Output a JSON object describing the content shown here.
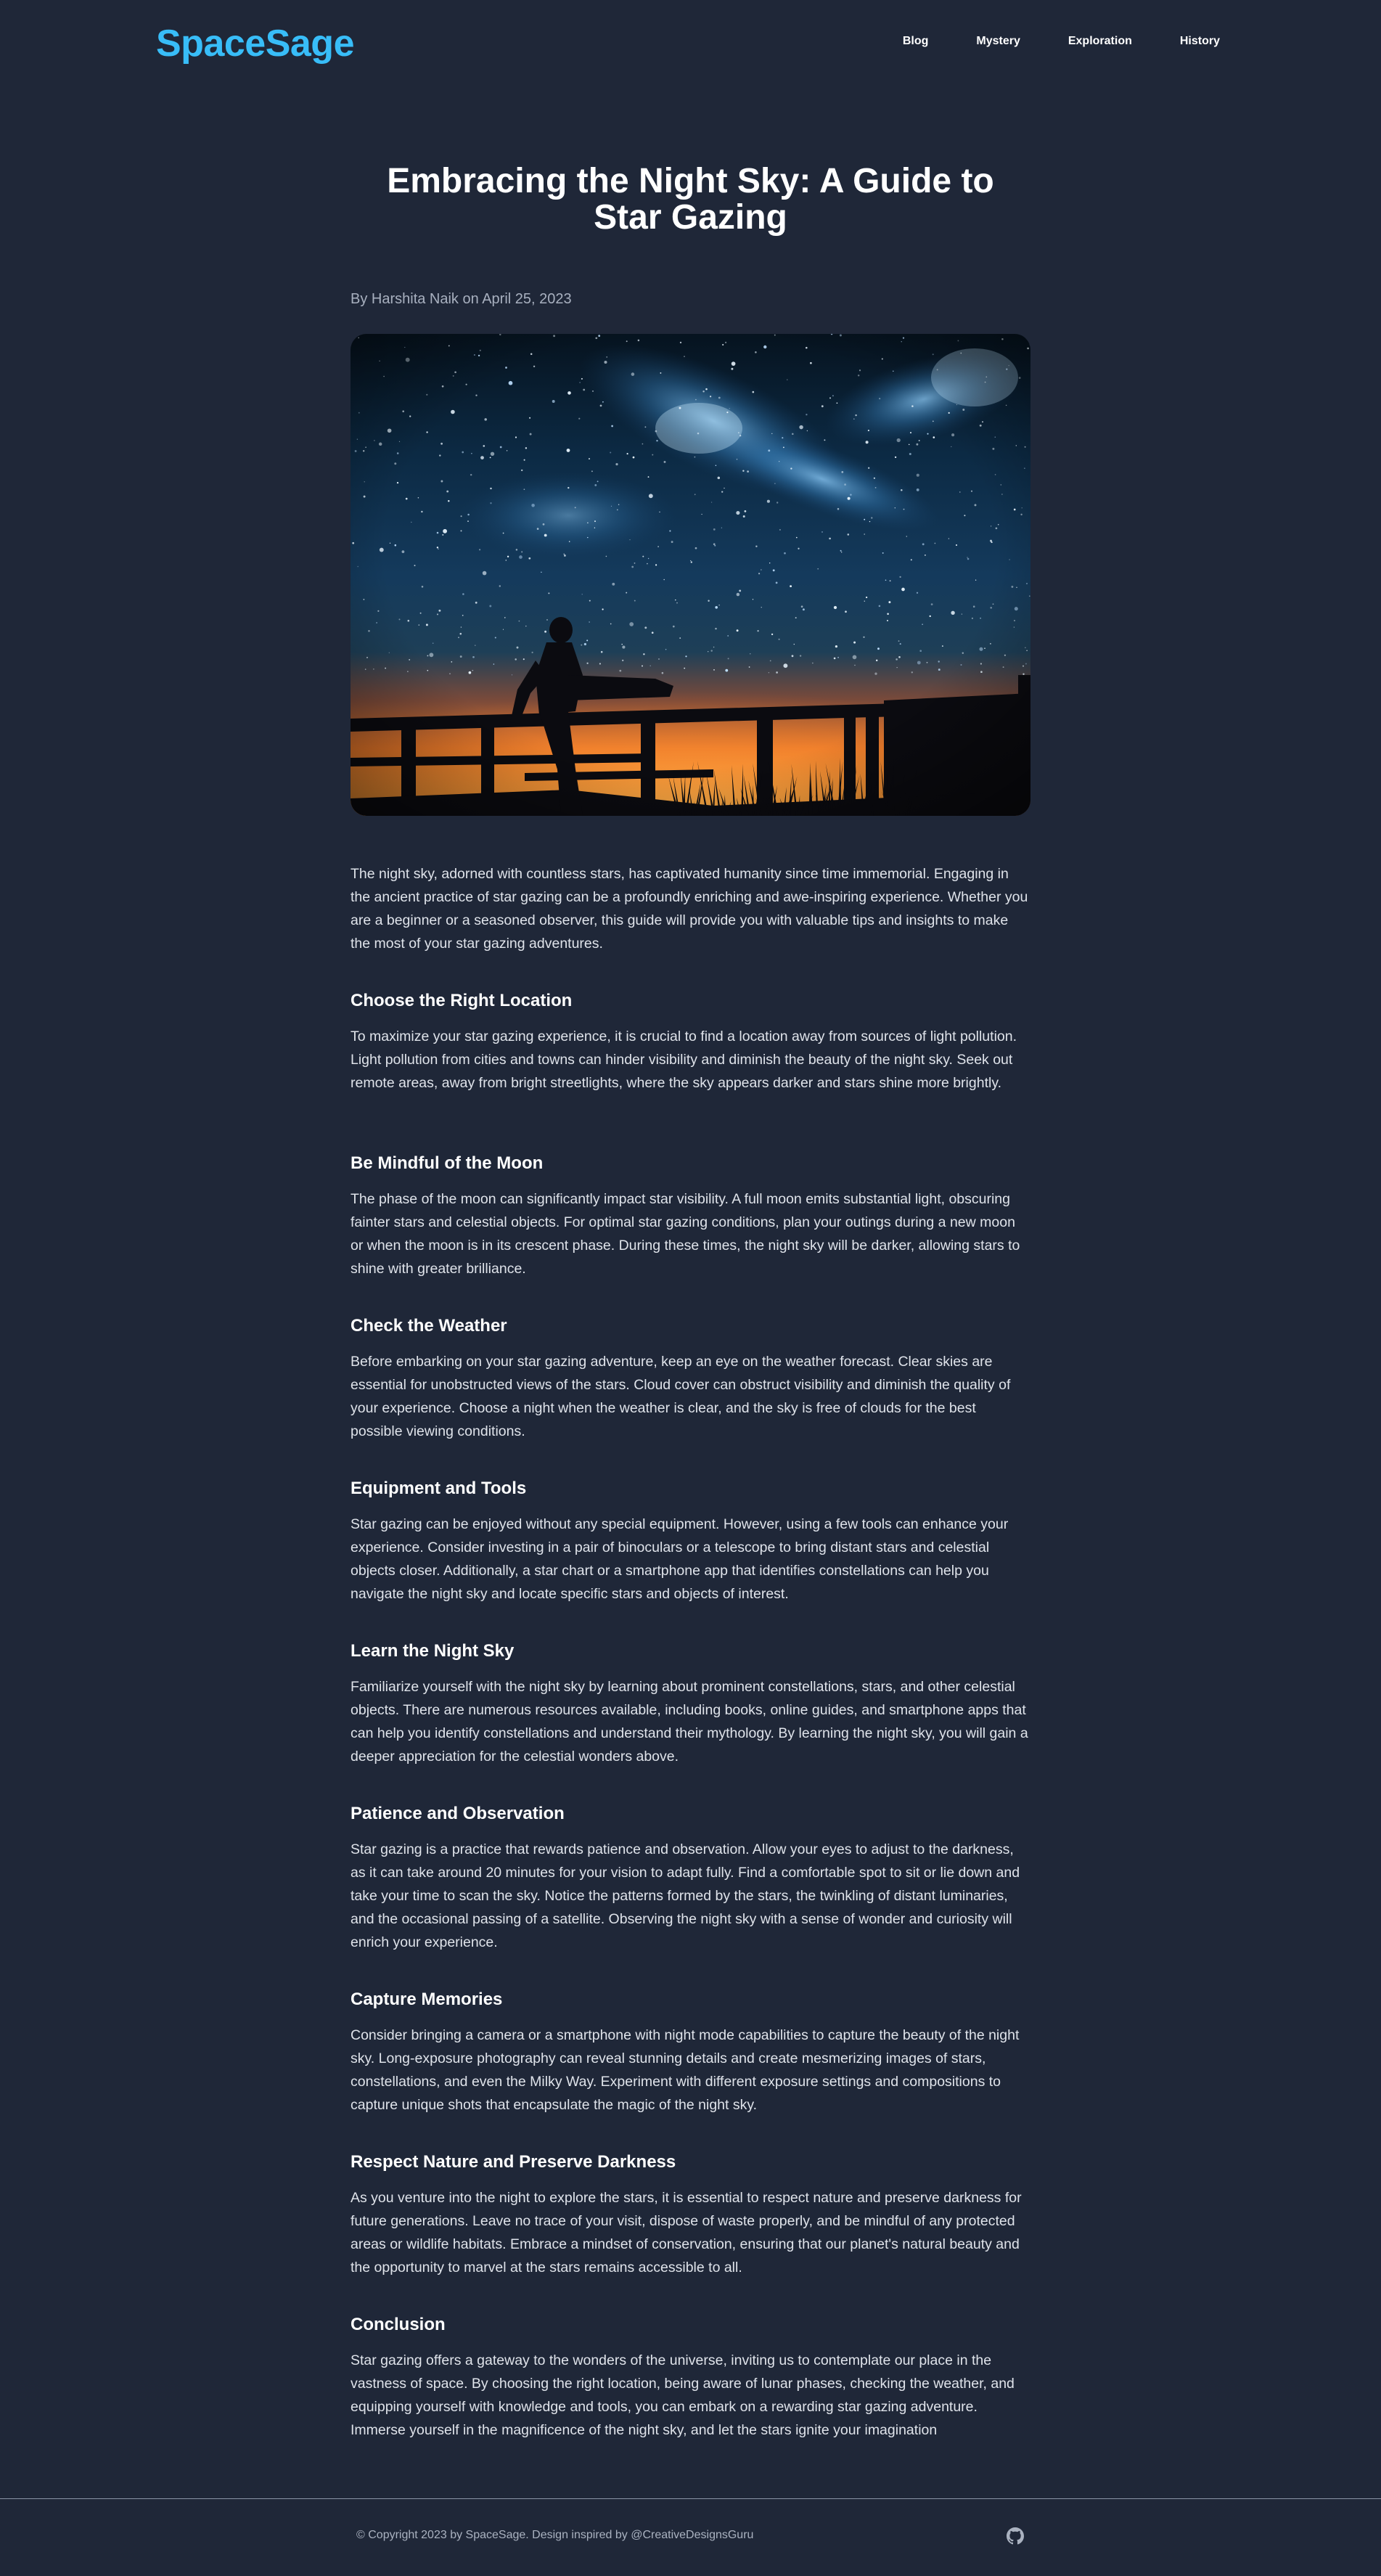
{
  "header": {
    "logo": "SpaceSage",
    "nav": [
      "Blog",
      "Mystery",
      "Exploration",
      "History"
    ]
  },
  "article": {
    "title": "Embracing the Night Sky: A Guide to Star Gazing",
    "byline": "By Harshita Naik on April 25, 2023",
    "intro": "The night sky, adorned with countless stars, has captivated humanity since time immemorial. Engaging in the ancient practice of star gazing can be a profoundly enriching and awe-inspiring experience. Whether you are a beginner or a seasoned observer, this guide will provide you with valuable tips and insights to make the most of your star gazing adventures.",
    "sections": [
      {
        "heading": "Choose the Right Location",
        "text": "To maximize your star gazing experience, it is crucial to find a location away from sources of light pollution. Light pollution from cities and towns can hinder visibility and diminish the beauty of the night sky. Seek out remote areas, away from bright streetlights, where the sky appears darker and stars shine more brightly."
      },
      {
        "heading": "Be Mindful of the Moon",
        "text": "The phase of the moon can significantly impact star visibility. A full moon emits substantial light, obscuring fainter stars and celestial objects. For optimal star gazing conditions, plan your outings during a new moon or when the moon is in its crescent phase. During these times, the night sky will be darker, allowing stars to shine with greater brilliance."
      },
      {
        "heading": "Check the Weather",
        "text": "Before embarking on your star gazing adventure, keep an eye on the weather forecast. Clear skies are essential for unobstructed views of the stars. Cloud cover can obstruct visibility and diminish the quality of your experience. Choose a night when the weather is clear, and the sky is free of clouds for the best possible viewing conditions."
      },
      {
        "heading": "Equipment and Tools",
        "text": "Star gazing can be enjoyed without any special equipment. However, using a few tools can enhance your experience. Consider investing in a pair of binoculars or a telescope to bring distant stars and celestial objects closer. Additionally, a star chart or a smartphone app that identifies constellations can help you navigate the night sky and locate specific stars and objects of interest."
      },
      {
        "heading": "Learn the Night Sky",
        "text": "Familiarize yourself with the night sky by learning about prominent constellations, stars, and other celestial objects. There are numerous resources available, including books, online guides, and smartphone apps that can help you identify constellations and understand their mythology. By learning the night sky, you will gain a deeper appreciation for the celestial wonders above."
      },
      {
        "heading": "Patience and Observation",
        "text": "Star gazing is a practice that rewards patience and observation. Allow your eyes to adjust to the darkness, as it can take around 20 minutes for your vision to adapt fully. Find a comfortable spot to sit or lie down and take your time to scan the sky. Notice the patterns formed by the stars, the twinkling of distant luminaries, and the occasional passing of a satellite. Observing the night sky with a sense of wonder and curiosity will enrich your experience."
      },
      {
        "heading": "Capture Memories",
        "text": "Consider bringing a camera or a smartphone with night mode capabilities to capture the beauty of the night sky. Long-exposure photography can reveal stunning details and create mesmerizing images of stars, constellations, and even the Milky Way. Experiment with different exposure settings and compositions to capture unique shots that encapsulate the magic of the night sky."
      },
      {
        "heading": "Respect Nature and Preserve Darkness",
        "text": "As you venture into the night to explore the stars, it is essential to respect nature and preserve darkness for future generations. Leave no trace of your visit, dispose of waste properly, and be mindful of any protected areas or wildlife habitats. Embrace a mindset of conservation, ensuring that our planet's natural beauty and the opportunity to marvel at the stars remains accessible to all."
      },
      {
        "heading": "Conclusion",
        "text": "Star gazing offers a gateway to the wonders of the universe, inviting us to contemplate our place in the vastness of space. By choosing the right location, being aware of lunar phases, checking the weather, and equipping yourself with knowledge and tools, you can embark on a rewarding star gazing adventure. Immerse yourself in the magnificence of the night sky, and let the stars ignite your imagination"
      }
    ]
  },
  "footer": {
    "copyright": "© Copyright 2023 by SpaceSage. Design inspired by @CreativeDesignsGuru",
    "icon": "github-icon"
  },
  "colors": {
    "background": "#1f2738",
    "logo": "#38bdf8"
  }
}
